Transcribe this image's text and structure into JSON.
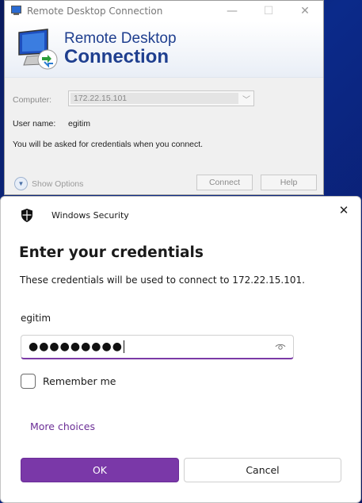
{
  "rdc_window": {
    "title": "Remote Desktop Connection",
    "banner_line1": "Remote Desktop",
    "banner_line2": "Connection",
    "computer_label": "Computer:",
    "computer_value": "172.22.15.101",
    "username_label": "User name:",
    "username_value": "egitim",
    "hint": "You will be asked for credentials when you connect.",
    "show_options": "Show Options",
    "connect_label": "Connect",
    "help_label": "Help",
    "controls": {
      "minimize": "—",
      "maximize": "☐",
      "close": "✕"
    }
  },
  "security_dialog": {
    "app_name": "Windows Security",
    "heading": "Enter your credentials",
    "description": "These credentials will be used to connect to 172.22.15.101.",
    "username": "egitim",
    "password_mask": "●●●●●●●●●",
    "remember_label": "Remember me",
    "remember_checked": false,
    "more_choices": "More choices",
    "ok_label": "OK",
    "cancel_label": "Cancel",
    "close_glyph": "✕"
  },
  "colors": {
    "accent": "#7a38a8",
    "link": "#6b2e96",
    "rdc_title_blue": "#1f3f8f",
    "desktop": "#0b2a8a"
  },
  "icons": [
    "rdc-app-icon",
    "rdc-monitor-icon",
    "shield-icon",
    "close-icon",
    "eye-icon",
    "expand-chevron-icon",
    "dropdown-chevron-icon"
  ]
}
